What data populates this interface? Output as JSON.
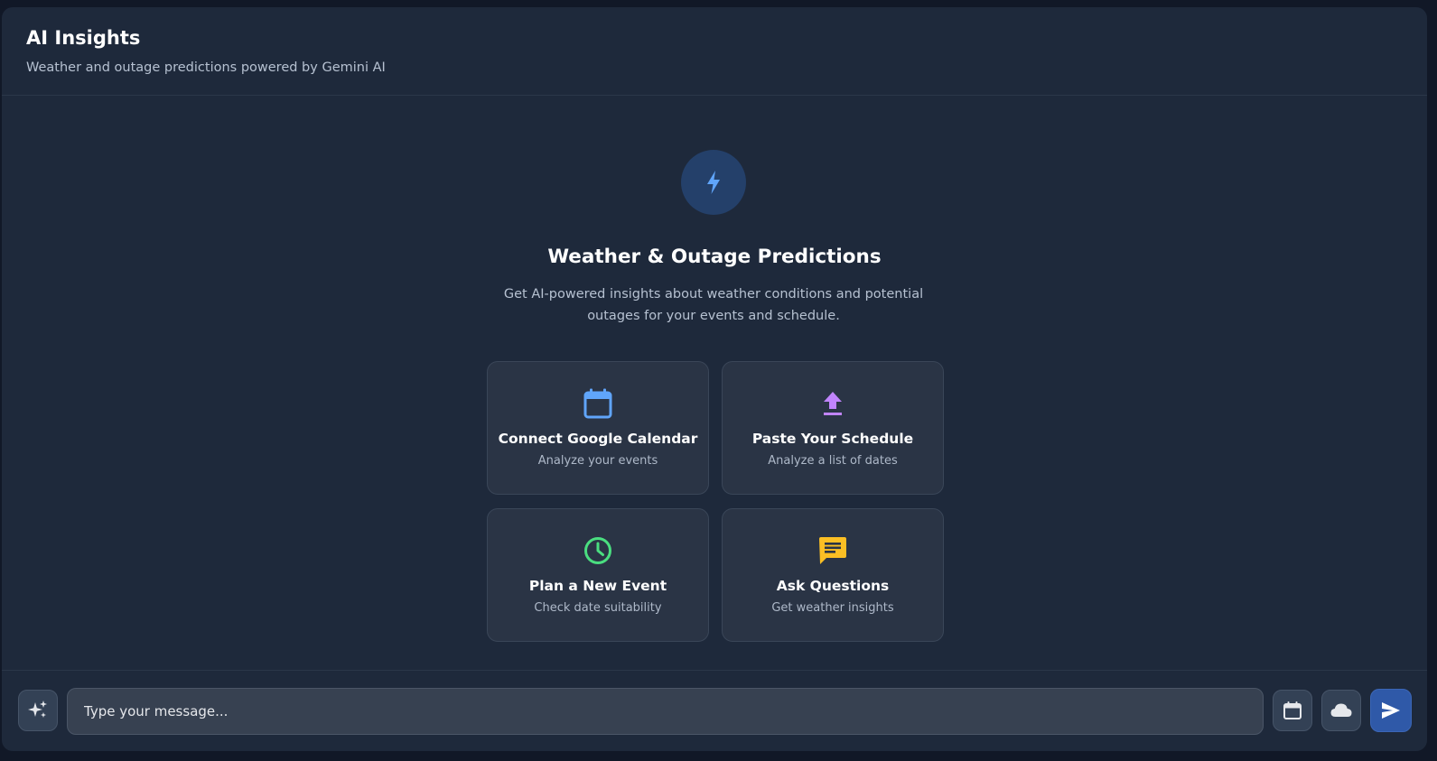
{
  "header": {
    "title": "AI Insights",
    "subtitle": "Weather and outage predictions powered by Gemini AI"
  },
  "hero": {
    "icon": "lightning-bolt-icon",
    "title": "Weather & Outage Predictions",
    "description": "Get AI-powered insights about weather conditions and potential outages for your events and schedule."
  },
  "cards": [
    {
      "title": "Connect Google Calendar",
      "subtitle": "Analyze your events",
      "icon": "calendar-icon",
      "color": "#60a5fa"
    },
    {
      "title": "Paste Your Schedule",
      "subtitle": "Analyze a list of dates",
      "icon": "upload-icon",
      "color": "#c084fc"
    },
    {
      "title": "Plan a New Event",
      "subtitle": "Check date suitability",
      "icon": "clock-icon",
      "color": "#4ade80"
    },
    {
      "title": "Ask Questions",
      "subtitle": "Get weather insights",
      "icon": "chat-icon",
      "color": "#fbbf24"
    }
  ],
  "composer": {
    "placeholder": "Type your message...",
    "left_icon": "sparkle-icon",
    "right_icons": [
      "calendar-icon",
      "cloud-icon",
      "send-icon"
    ]
  },
  "colors": {
    "background": "#111827",
    "panel": "#1e293b",
    "card": "#2a3445",
    "accent": "#2f59a8",
    "hero_icon": "#60a5fa"
  }
}
